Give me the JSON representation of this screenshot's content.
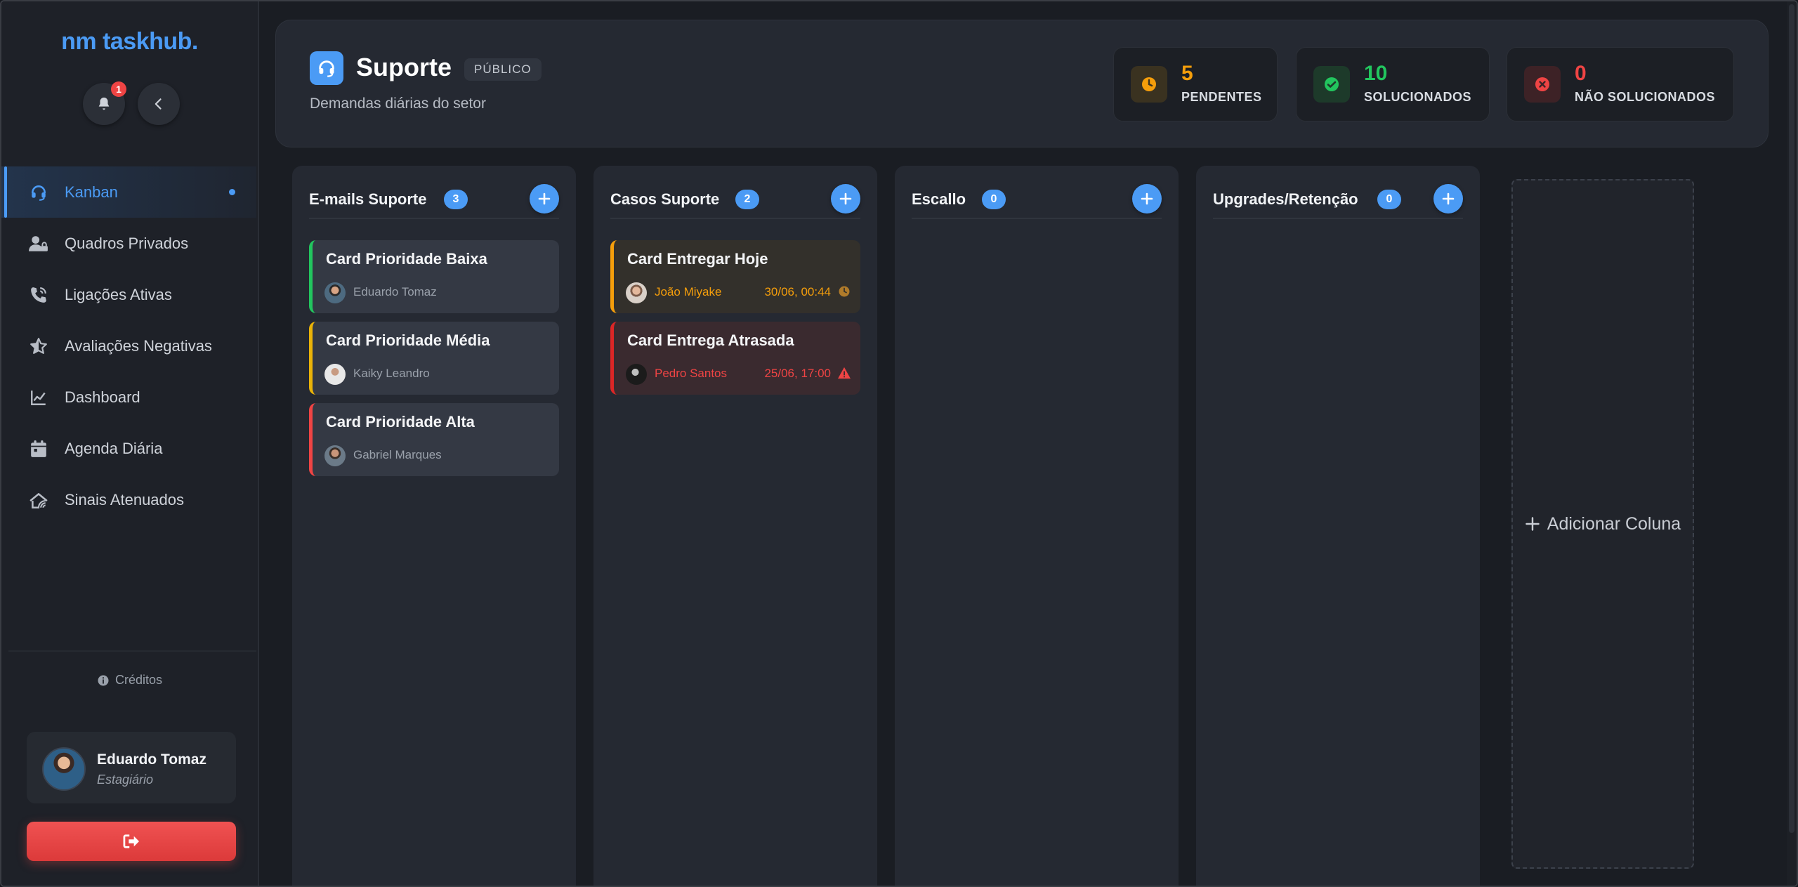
{
  "app": {
    "logo": "nm taskhub.",
    "notifications_count": "1"
  },
  "sidebar": {
    "items": [
      {
        "label": "Kanban",
        "icon": "headset-icon",
        "active": true
      },
      {
        "label": "Quadros Privados",
        "icon": "user-lock-icon"
      },
      {
        "label": "Ligações Ativas",
        "icon": "phone-call-icon"
      },
      {
        "label": "Avaliações Negativas",
        "icon": "star-half-icon"
      },
      {
        "label": "Dashboard",
        "icon": "chart-line-icon"
      },
      {
        "label": "Agenda Diária",
        "icon": "calendar-icon"
      },
      {
        "label": "Sinais Atenuados",
        "icon": "signal-icon"
      }
    ],
    "credits_label": "Créditos",
    "user": {
      "name": "Eduardo Tomaz",
      "role": "Estagiário"
    }
  },
  "header": {
    "title": "Suporte",
    "tag": "PÚBLICO",
    "subtitle": "Demandas diárias do setor",
    "stats": {
      "pending": {
        "value": "5",
        "label": "PENDENTES",
        "color": "#f59e0b"
      },
      "solved": {
        "value": "10",
        "label": "SOLUCIONADOS",
        "color": "#22c55e"
      },
      "unsolved": {
        "value": "0",
        "label": "NÃO SOLUCIONADOS",
        "color": "#ef4444"
      }
    }
  },
  "board": {
    "columns": [
      {
        "title": "E-mails Suporte",
        "count": "3",
        "cards": [
          {
            "title": "Card Prioridade Baixa",
            "user": "Eduardo Tomaz",
            "priority": "low"
          },
          {
            "title": "Card Prioridade Média",
            "user": "Kaiky Leandro",
            "priority": "medium"
          },
          {
            "title": "Card Prioridade Alta",
            "user": "Gabriel Marques",
            "priority": "high"
          }
        ]
      },
      {
        "title": "Casos Suporte",
        "count": "2",
        "cards": [
          {
            "title": "Card Entregar Hoje",
            "user": "João Miyake",
            "date": "30/06, 00:44",
            "status": "due-today"
          },
          {
            "title": "Card Entrega Atrasada",
            "user": "Pedro Santos",
            "date": "25/06, 17:00",
            "status": "overdue"
          }
        ]
      },
      {
        "title": "Escallo",
        "count": "0",
        "cards": []
      },
      {
        "title": "Upgrades/Retenção",
        "count": "0",
        "cards": []
      }
    ],
    "add_column_label": "Adicionar Coluna"
  },
  "colors": {
    "accent": "#4b9bf5",
    "due_today": "#f59e0b",
    "overdue": "#ef4444"
  }
}
